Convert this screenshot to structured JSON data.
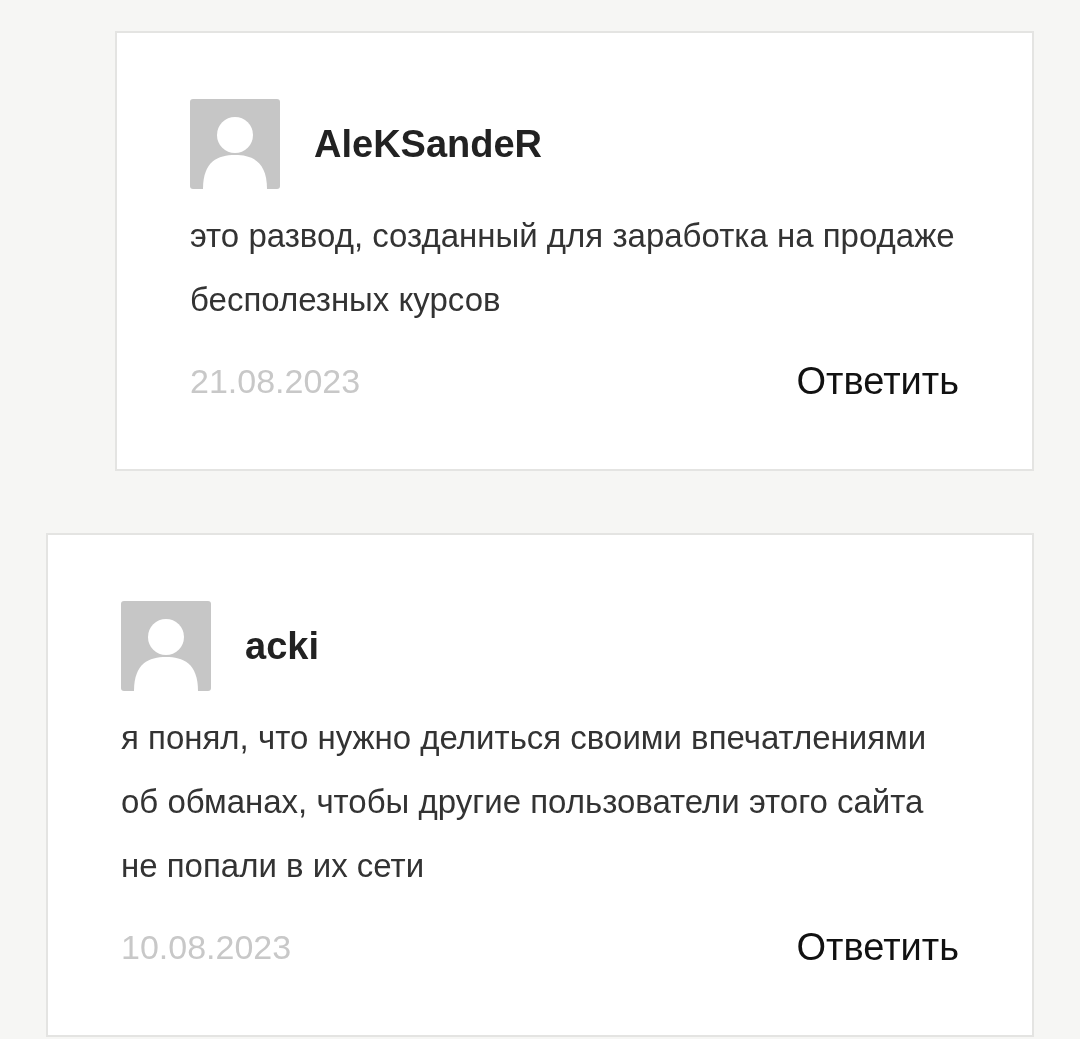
{
  "comments": [
    {
      "author": "AleKSandeR",
      "nested": true,
      "text": "это развод, созданный для заработка на продаже бесполезных курсов",
      "date": "21.08.2023",
      "reply": "Ответить"
    },
    {
      "author": "acki",
      "nested": false,
      "text": "я понял, что нужно делиться своими впечатлениями об обманах, чтобы другие пользователи этого сайта не попали в их сети",
      "date": "10.08.2023",
      "reply": "Ответить"
    }
  ]
}
